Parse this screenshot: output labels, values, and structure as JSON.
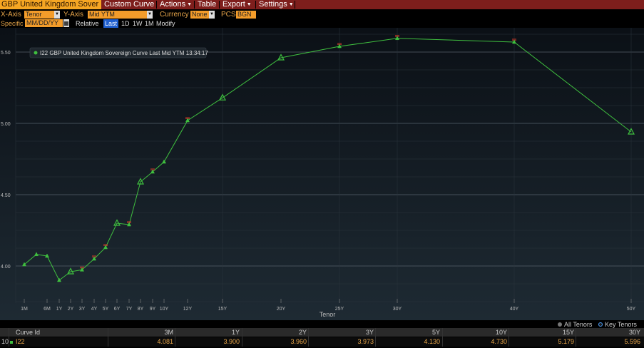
{
  "menubar": {
    "title": "GBP United Kingdom Sover",
    "items": [
      "Custom Curve",
      "Actions",
      "Table",
      "Export",
      "Settings"
    ]
  },
  "controls": {
    "xaxis_label": "X-Axis",
    "xaxis_value": "Tenor",
    "yaxis_label": "Y-Axis",
    "yaxis_value": "Mid YTM",
    "currency_label": "Currency",
    "currency_value": "None",
    "pcs_label": "PCS",
    "pcs_value": "BGN",
    "specific_label": "Specific",
    "date_placeholder": "MM/DD/YY",
    "relative_label": "Relative",
    "ranges": [
      "Last",
      "1D",
      "1W",
      "1M",
      "Modify"
    ],
    "active_range": "Last"
  },
  "legend_box": "I22 GBP United Kingdom Sovereign Curve Last Mid YTM 13:34:17",
  "footer_legend": {
    "all_tenors": "All Tenors",
    "key_tenors": "Key Tenors"
  },
  "table": {
    "headers": [
      "Curve Id",
      "3M",
      "1Y",
      "2Y",
      "3Y",
      "5Y",
      "10Y",
      "15Y",
      "30Y"
    ],
    "row_num": "10",
    "row": [
      "I22",
      "4.081",
      "3.900",
      "3.960",
      "3.973",
      "4.130",
      "4.730",
      "5.179",
      "5.596"
    ]
  },
  "colors": {
    "line": "#3fbf3f",
    "menu_bg": "#7e1e1c",
    "accent": "#f39c2a",
    "bid_marker": "#d23a2a"
  },
  "chart_data": {
    "type": "line",
    "xlabel": "Tenor",
    "ylabel": "",
    "x_ticks": [
      "1M",
      "6M",
      "1Y",
      "2Y",
      "3Y",
      "4Y",
      "5Y",
      "6Y",
      "7Y",
      "8Y",
      "9Y",
      "10Y",
      "12Y",
      "15Y",
      "20Y",
      "25Y",
      "30Y",
      "40Y",
      "50Y"
    ],
    "y_ticks": [
      "4.00",
      "4.50",
      "5.00",
      "5.50"
    ],
    "ylim": [
      3.74,
      5.67
    ],
    "grid": true,
    "series": [
      {
        "name": "I22 GBP United Kingdom Sovereign Curve Last Mid YTM 13:34:17",
        "points": [
          {
            "x": "1M",
            "y": 4.01
          },
          {
            "x": "3M",
            "y": 4.081
          },
          {
            "x": "6M",
            "y": 4.07
          },
          {
            "x": "1Y",
            "y": 3.9
          },
          {
            "x": "2Y",
            "y": 3.96
          },
          {
            "x": "3Y",
            "y": 3.973
          },
          {
            "x": "4Y",
            "y": 4.05
          },
          {
            "x": "5Y",
            "y": 4.13
          },
          {
            "x": "6Y",
            "y": 4.3
          },
          {
            "x": "7Y",
            "y": 4.29
          },
          {
            "x": "8Y",
            "y": 4.59
          },
          {
            "x": "9Y",
            "y": 4.66
          },
          {
            "x": "10Y",
            "y": 4.73
          },
          {
            "x": "12Y",
            "y": 5.02
          },
          {
            "x": "15Y",
            "y": 5.179
          },
          {
            "x": "20Y",
            "y": 5.46
          },
          {
            "x": "25Y",
            "y": 5.54
          },
          {
            "x": "30Y",
            "y": 5.596
          },
          {
            "x": "40Y",
            "y": 5.57
          },
          {
            "x": "50Y",
            "y": 4.94
          }
        ],
        "key_tenors": [
          "2Y",
          "6Y",
          "8Y",
          "15Y",
          "20Y",
          "50Y"
        ],
        "bid_markers": [
          "3Y",
          "4Y",
          "5Y",
          "7Y",
          "9Y",
          "12Y",
          "25Y",
          "30Y",
          "40Y"
        ]
      }
    ]
  }
}
